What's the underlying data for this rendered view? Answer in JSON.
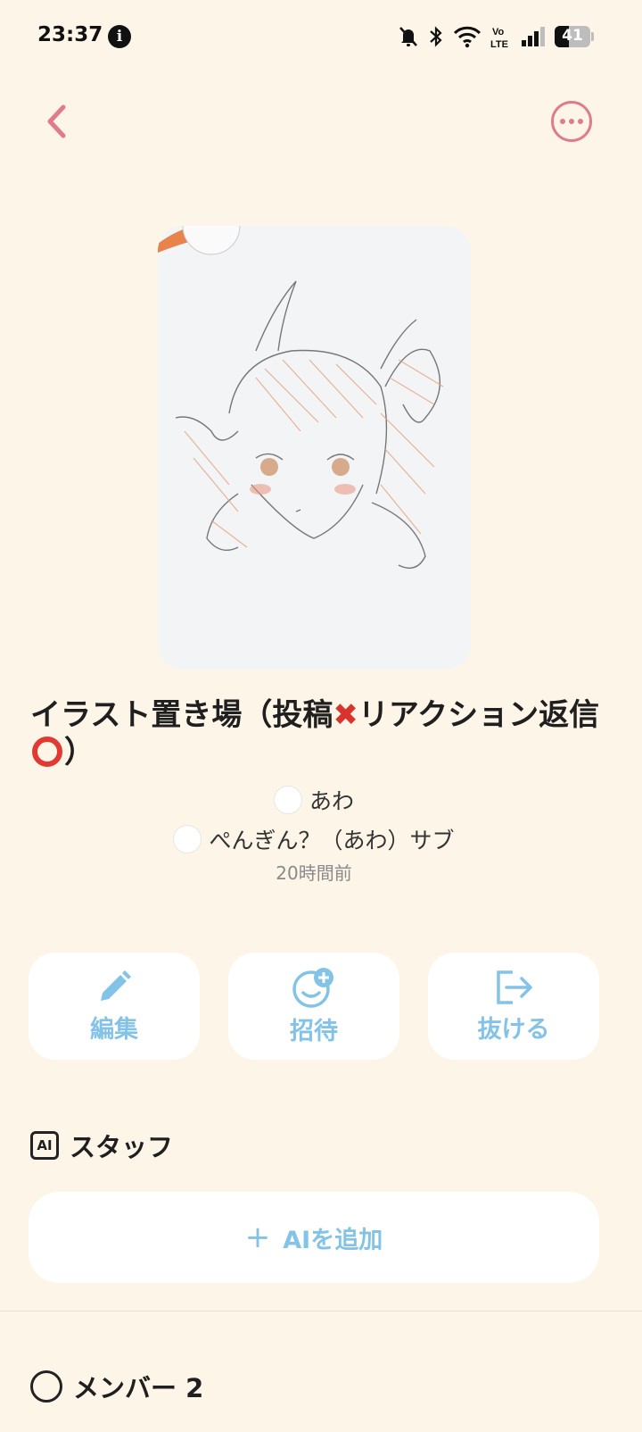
{
  "status": {
    "time": "23:37",
    "battery": "41"
  },
  "room": {
    "title": "イラスト置き場（投稿",
    "title_mid": "リアクション返信",
    "title_end": "）",
    "owner": "あわ",
    "sub_owner": "ぺんぎん？（あわ）サブ",
    "updated": "20時間前"
  },
  "actions": {
    "edit": "編集",
    "invite": "招待",
    "leave": "抜ける"
  },
  "staff": {
    "heading": "スタッフ",
    "badge": "AI",
    "add_label": "AIを追加",
    "add_prefix": "+"
  },
  "members": {
    "heading": "メンバー 2"
  },
  "colors": {
    "background": "#fdf6e8",
    "accent": "#84c3e8",
    "back_icon": "#e07b8d"
  }
}
